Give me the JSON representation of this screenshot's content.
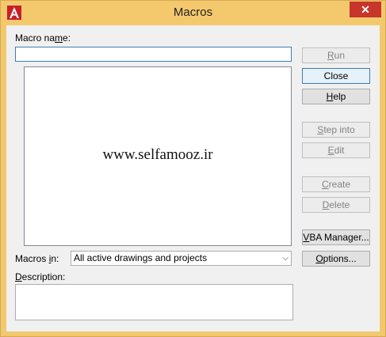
{
  "window": {
    "title": "Macros",
    "close_glyph": "✕",
    "app_icon": "autocad-icon"
  },
  "macro_name": {
    "label_pre": "Macro na",
    "label_key": "m",
    "label_post": "e:",
    "value": ""
  },
  "watermark": "www.selfamooz.ir",
  "buttons": {
    "run": {
      "pre": "",
      "key": "R",
      "post": "un"
    },
    "close": {
      "label": "Close"
    },
    "help": {
      "pre": "",
      "key": "H",
      "post": "elp"
    },
    "step_into": {
      "pre": "",
      "key": "S",
      "post": "tep into"
    },
    "edit": {
      "pre": "",
      "key": "E",
      "post": "dit"
    },
    "create": {
      "pre": "",
      "key": "C",
      "post": "reate"
    },
    "delete": {
      "pre": "",
      "key": "D",
      "post": "elete"
    },
    "vba_manager": {
      "pre": "",
      "key": "V",
      "post": "BA Manager..."
    },
    "options": {
      "pre": "",
      "key": "O",
      "post": "ptions..."
    }
  },
  "macros_in": {
    "label_pre": "Macros ",
    "label_key": "i",
    "label_post": "n:",
    "selected": "All active drawings and projects"
  },
  "description": {
    "label_pre": "",
    "label_key": "D",
    "label_post": "escription:"
  }
}
